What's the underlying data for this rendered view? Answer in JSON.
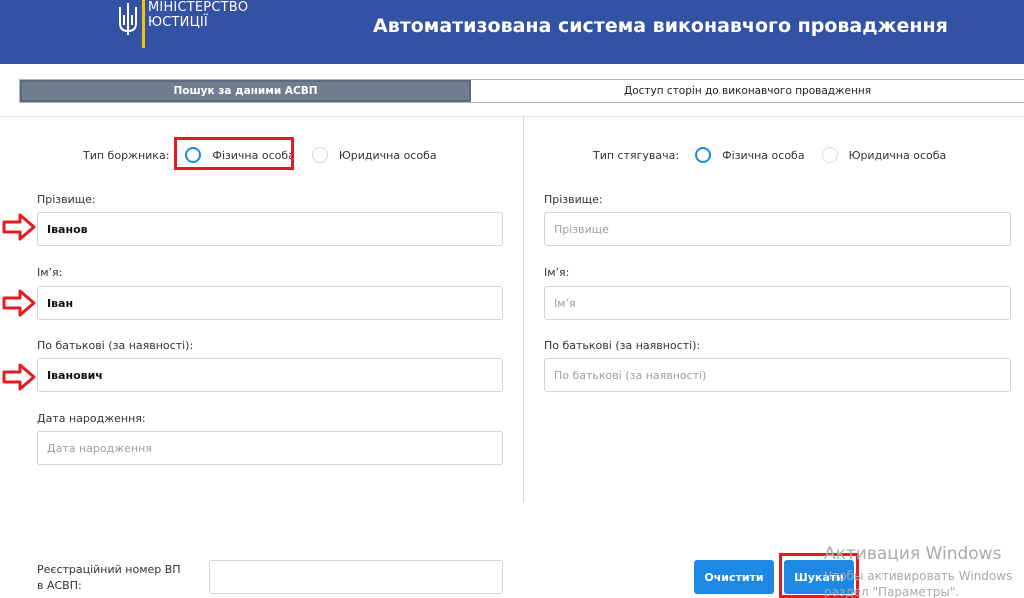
{
  "header": {
    "logo_line1": "МІНІСТЕРСТВО",
    "logo_line2": "ЮСТИЦІЇ",
    "title": "Автоматизована система виконавчого провадження"
  },
  "tabs": [
    {
      "label": "Пошук за даними АСВП",
      "active": true
    },
    {
      "label": "Доступ сторін до виконавчого провадження",
      "active": false
    }
  ],
  "debtor": {
    "type_label": "Тип боржника:",
    "options": [
      "Фізична особа",
      "Юридична особа"
    ],
    "selected": "Фізична особа",
    "surname_label": "Прізвище:",
    "surname_value": "Іванов",
    "name_label": "Ім’я:",
    "name_value": "Іван",
    "patronymic_label": "По батькові (за наявності):",
    "patronymic_value": "Іванович",
    "birthdate_label": "Дата народження:",
    "birthdate_placeholder": "Дата народження"
  },
  "creditor": {
    "type_label": "Тип стягувача:",
    "options": [
      "Фізична особа",
      "Юридична особа"
    ],
    "selected": "Фізична особа",
    "surname_label": "Прізвище:",
    "surname_placeholder": "Прізвище",
    "name_label": "Ім’я:",
    "name_placeholder": "Ім’я",
    "patronymic_label": "По батькові (за наявності):",
    "patronymic_placeholder": "По батькові (за наявності)"
  },
  "reg_number": {
    "label_line1": "Реєстраційний номер ВП",
    "label_line2": "в АСВП:",
    "value": ""
  },
  "buttons": {
    "clear": "Очистити",
    "search": "Шукати"
  },
  "watermark": {
    "title": "Активация Windows",
    "line2": "Чтобы активировать Windows",
    "line3": "раздел \"Параметры\"."
  },
  "colors": {
    "header_bg": "#3452a3",
    "accent": "#1e88e5",
    "highlight": "#e31b23",
    "tab_active": "#6f7f8f"
  }
}
